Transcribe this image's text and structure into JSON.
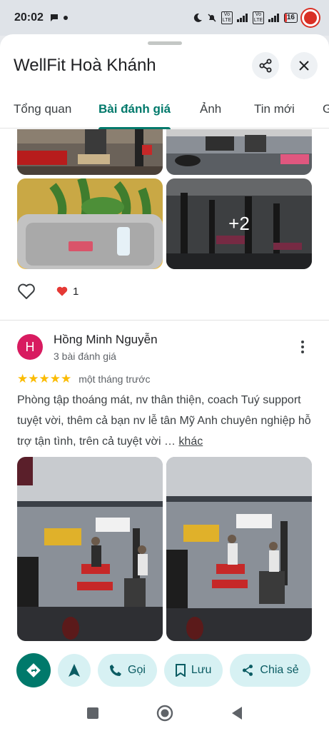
{
  "status_bar": {
    "time": "20:02",
    "battery": "16",
    "battery_level": 0.16,
    "network_label_1": "Vo LTE",
    "network_label_2": "Vo LTE"
  },
  "header": {
    "title": "WellFit Hoà Khánh"
  },
  "tabs": [
    {
      "label": "Tổng quan"
    },
    {
      "label": "Bài đánh giá"
    },
    {
      "label": "Ảnh"
    },
    {
      "label": "Tin mới"
    },
    {
      "label": "G"
    }
  ],
  "previous_review": {
    "more_photos": "+2",
    "reaction_count": "1"
  },
  "review": {
    "avatar_letter": "H",
    "reviewer_name": "Hồng Minh Nguyễn",
    "reviewer_meta": "3 bài đánh giá",
    "rating": 5,
    "stars": "★★★★★",
    "date": "một tháng trước",
    "text": "Phòng tập thoáng mát, nv thân thiện, coach Tuý support tuyệt vời, thêm cả bạn nv lễ tân Mỹ Anh chuyên nghiệp hỗ trợ tận tình, trên cả tuyệt vời …",
    "more_label": "khác"
  },
  "actions": {
    "call": "Gọi",
    "save": "Lưu",
    "share": "Chia sẻ"
  },
  "colors": {
    "accent": "#00796b",
    "chip_bg": "#d7f1f3",
    "star": "#fbbc04",
    "avatar": "#d81b60"
  }
}
